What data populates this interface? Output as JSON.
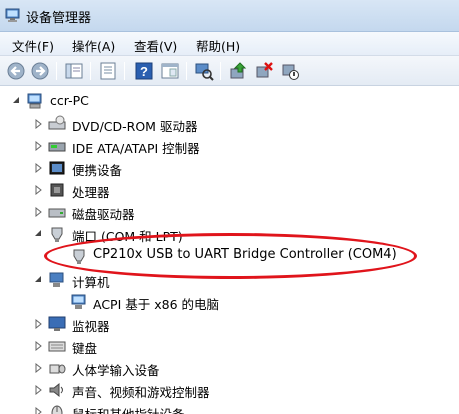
{
  "window": {
    "title": "设备管理器"
  },
  "menu": {
    "file": "文件(F)",
    "action": "操作(A)",
    "view": "查看(V)",
    "help": "帮助(H)"
  },
  "toolbar": {
    "icons": [
      "back-arrow-icon",
      "forward-arrow-icon",
      "console-tree-icon",
      "properties-icon",
      "help-icon",
      "show-hide-icon",
      "scan-hardware-icon",
      "update-driver-icon",
      "uninstall-icon",
      "disable-device-icon"
    ]
  },
  "tree": {
    "root": "ccr-PC",
    "items": [
      {
        "label": "DVD/CD-ROM 驱动器",
        "icon": "dvd-drive-icon"
      },
      {
        "label": "IDE ATA/ATAPI 控制器",
        "icon": "ide-controller-icon"
      },
      {
        "label": "便携设备",
        "icon": "portable-device-icon"
      },
      {
        "label": "处理器",
        "icon": "processor-icon"
      },
      {
        "label": "磁盘驱动器",
        "icon": "disk-drive-icon"
      },
      {
        "label": "端口 (COM 和 LPT)",
        "icon": "port-icon",
        "expanded": true
      },
      {
        "label": "CP210x USB to UART Bridge Controller (COM4)",
        "icon": "port-device-icon",
        "child": true,
        "highlighted": true
      },
      {
        "label": "计算机",
        "icon": "computer-icon",
        "expanded": true
      },
      {
        "label": "ACPI 基于 x86 的电脑",
        "icon": "pc-icon",
        "child": true
      },
      {
        "label": "监视器",
        "icon": "monitor-icon"
      },
      {
        "label": "键盘",
        "icon": "keyboard-icon"
      },
      {
        "label": "人体学输入设备",
        "icon": "hid-icon"
      },
      {
        "label": "声音、视频和游戏控制器",
        "icon": "sound-icon"
      },
      {
        "label": "鼠标和其他指针设备",
        "icon": "mouse-icon"
      }
    ]
  },
  "colors": {
    "highlight_ring": "#e0141b",
    "titlebar": "#c4d8ee"
  }
}
